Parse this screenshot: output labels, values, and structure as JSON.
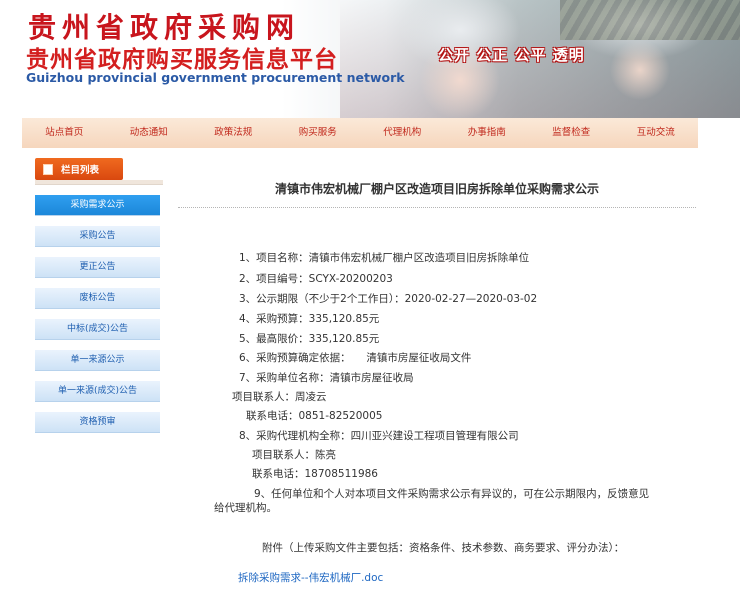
{
  "header": {
    "logo_cn_1": "贵州省政府采购网",
    "logo_cn_2": "贵州省政府购买服务信息平台",
    "logo_en": "Guizhou provincial government procurement network",
    "slogan": "公开 公正 公平 透明"
  },
  "nav": [
    "站点首页",
    "动态通知",
    "政策法规",
    "购买服务",
    "代理机构",
    "办事指南",
    "监督检查",
    "互动交流"
  ],
  "sidebar": {
    "title": "栏目列表",
    "items": [
      "采购需求公示",
      "采购公告",
      "更正公告",
      "废标公告",
      "中标(成交)公告",
      "单一来源公示",
      "单一来源(成交)公告",
      "资格预审"
    ],
    "active_index": 0
  },
  "article": {
    "title": "清镇市伟宏机械厂棚户区改造项目旧房拆除单位采购需求公示",
    "lines": [
      "1、项目名称：清镇市伟宏机械厂棚户区改造项目旧房拆除单位",
      "2、项目编号：SCYX-20200203",
      "3、公示期限（不少于2个工作日）：2020-02-27—2020-03-02",
      "4、采购预算：335,120.85元",
      "5、最高限价：335,120.85元",
      "6、采购预算确定依据：　　清镇市房屋征收局文件",
      "7、采购单位名称：清镇市房屋征收局",
      "项目联系人：周凌云",
      "联系电话：0851-82520005",
      "8、采购代理机构全称：四川亚兴建设工程项目管理有限公司",
      "项目联系人：陈亮",
      "联系电话：18708511986",
      "9、任何单位和个人对本项目文件采购需求公示有异议的，可在公示期限内，反馈意见",
      "给代理机构。"
    ],
    "attachment_label": "附件（上传采购文件主要包括：资格条件、技术参数、商务要求、评分办法）：",
    "attachment_file": "拆除采购需求--伟宏机械厂.doc"
  }
}
